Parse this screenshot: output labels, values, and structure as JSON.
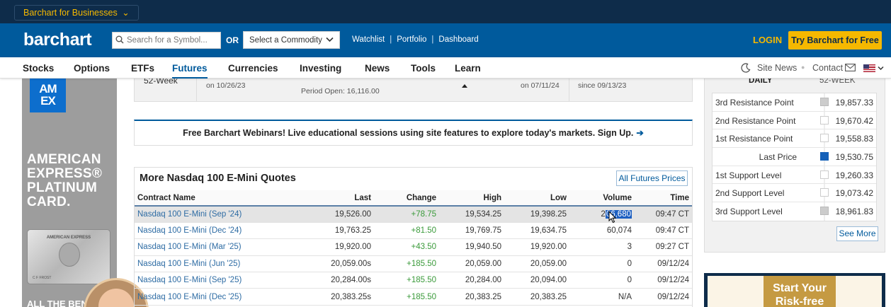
{
  "header": {
    "businesses_label": "Barchart for Businesses",
    "logo": "barchart",
    "search_placeholder": "Search for a Symbol...",
    "or_label": "OR",
    "commodity_select": "Select a Commodity",
    "links": [
      "Watchlist",
      "Portfolio",
      "Dashboard"
    ],
    "login": "LOGIN",
    "try_button": "Try Barchart for Free"
  },
  "nav": {
    "items": [
      "Stocks",
      "Options",
      "ETFs",
      "Futures",
      "Currencies",
      "Investing",
      "News",
      "Tools",
      "Learn"
    ],
    "active": "Futures",
    "site_news": "Site News",
    "contact": "Contact"
  },
  "left_ad": {
    "logo_line1": "AM",
    "logo_line2": "EX",
    "text_lines": [
      "AMERICAN",
      "EXPRESS®",
      "PLATINUM",
      "CARD."
    ],
    "card_title": "AMERICAN EXPRESS",
    "card_name": "C F FROST",
    "bottom_text": "ALL THE BEN"
  },
  "week_row": {
    "label": "52-Week",
    "low_date": "on 10/26/23",
    "period_open": "Period Open: 16,116.00",
    "high_date": "on 07/11/24",
    "since": "since 09/13/23"
  },
  "webinar": {
    "text": "Free Barchart Webinars! Live educational sessions using site features to explore today's markets. Sign Up.",
    "arrow": "➔"
  },
  "quotes": {
    "title": "More Nasdaq 100 E-Mini Quotes",
    "all_futures_button": "All Futures Prices",
    "columns": [
      "Contract Name",
      "Last",
      "Change",
      "High",
      "Low",
      "Volume",
      "Time"
    ],
    "rows": [
      {
        "name": "Nasdaq 100 E-Mini (Sep '24)",
        "last": "19,526.00",
        "change": "+78.75",
        "high": "19,534.25",
        "low": "19,398.25",
        "volume_pre": "2",
        "volume_sel": "06,680",
        "time": "09:47 CT"
      },
      {
        "name": "Nasdaq 100 E-Mini (Dec '24)",
        "last": "19,763.25",
        "change": "+81.50",
        "high": "19,769.75",
        "low": "19,634.75",
        "volume": "60,074",
        "time": "09:47 CT"
      },
      {
        "name": "Nasdaq 100 E-Mini (Mar '25)",
        "last": "19,920.00",
        "change": "+43.50",
        "high": "19,940.50",
        "low": "19,920.00",
        "volume": "3",
        "time": "09:27 CT"
      },
      {
        "name": "Nasdaq 100 E-Mini (Jun '25)",
        "last": "20,059.00s",
        "change": "+185.50",
        "high": "20,059.00",
        "low": "20,059.00",
        "volume": "0",
        "time": "09/12/24"
      },
      {
        "name": "Nasdaq 100 E-Mini (Sep '25)",
        "last": "20,284.00s",
        "change": "+185.50",
        "high": "20,284.00",
        "low": "20,094.00",
        "volume": "0",
        "time": "09/12/24"
      },
      {
        "name": "Nasdaq 100 E-Mini (Dec '25)",
        "last": "20,383.25s",
        "change": "+185.50",
        "high": "20,383.25",
        "low": "20,383.25",
        "volume": "N/A",
        "time": "09/12/24"
      }
    ]
  },
  "side_panel": {
    "daily": "DAILY",
    "week52": "52-WEEK",
    "rows": [
      {
        "label": "3rd Resistance Point",
        "value": "19,857.33",
        "mark": "gray"
      },
      {
        "label": "2nd Resistance Point",
        "value": "19,670.42",
        "mark": "white"
      },
      {
        "label": "1st Resistance Point",
        "value": "19,558.83",
        "mark": "white"
      },
      {
        "label": "Last Price",
        "value": "19,530.75",
        "mark": "blue"
      },
      {
        "label": "1st Support Level",
        "value": "19,260.33",
        "mark": "white"
      },
      {
        "label": "2nd Support Level",
        "value": "19,073.42",
        "mark": "white"
      },
      {
        "label": "3rd Support Level",
        "value": "18,961.83",
        "mark": "gray"
      }
    ],
    "see_more": "See More"
  },
  "right_ad": {
    "line1": "Start Your",
    "line2": "Risk-free"
  },
  "colors": {
    "topbar": "#0e2c4a",
    "brand_blue": "#005a9c",
    "accent_yellow": "#f5b800",
    "positive_green": "#3a9a3a"
  }
}
